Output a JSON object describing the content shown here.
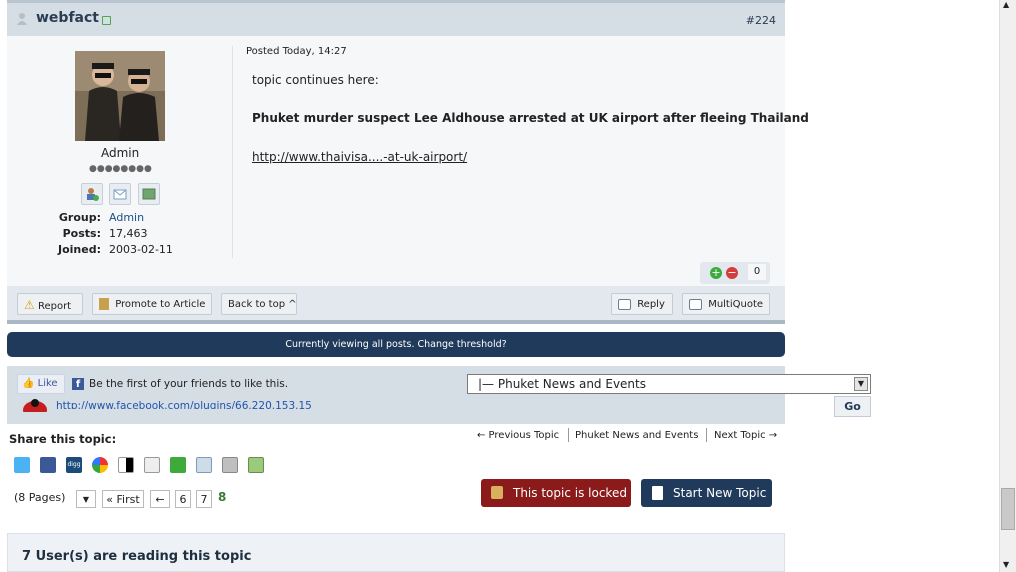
{
  "post": {
    "author": "webfact",
    "number": "#224",
    "posted": "Posted Today, 14:27",
    "body_intro": "topic continues here:",
    "headline": "Phuket murder suspect Lee Aldhouse arrested at UK airport after fleeing Thailand",
    "link": "http://www.thaivisa....-at-uk-airport/",
    "rating": "0"
  },
  "author_info": {
    "role": "Admin",
    "group_label": "Group:",
    "group": "Admin",
    "posts_label": "Posts:",
    "posts": "17,463",
    "joined_label": "Joined:",
    "joined": "2003-02-11"
  },
  "footer": {
    "report": "Report",
    "promote": "Promote to Article",
    "back_to_top": "Back to top ^",
    "reply": "Reply",
    "multiquote": "MultiQuote"
  },
  "threshold": "Currently viewing all posts. Change threshold?",
  "social": {
    "like": "Like",
    "like_text": "Be the first of your friends to like this.",
    "fb_link": "http://www.facebook.com/plugins/66.220.153.15",
    "forum_select": "|— Phuket News and Events",
    "go": "Go"
  },
  "share": {
    "title": "Share this topic:",
    "prev_topic": "← Previous Topic",
    "forum": "Phuket News and Events",
    "next_topic": "Next Topic →"
  },
  "pagination": {
    "pages": "(8 Pages)",
    "first": "« First",
    "back": "←",
    "p6": "6",
    "p7": "7",
    "p8": "8"
  },
  "actions": {
    "locked": "This topic is locked",
    "new_topic": "Start New Topic"
  },
  "readers": {
    "title": "7 User(s) are reading this topic"
  },
  "colors": {
    "header_bg": "#d5dde5",
    "dark_blue": "#1f3a5a",
    "locked_red": "#8b1a1a"
  }
}
